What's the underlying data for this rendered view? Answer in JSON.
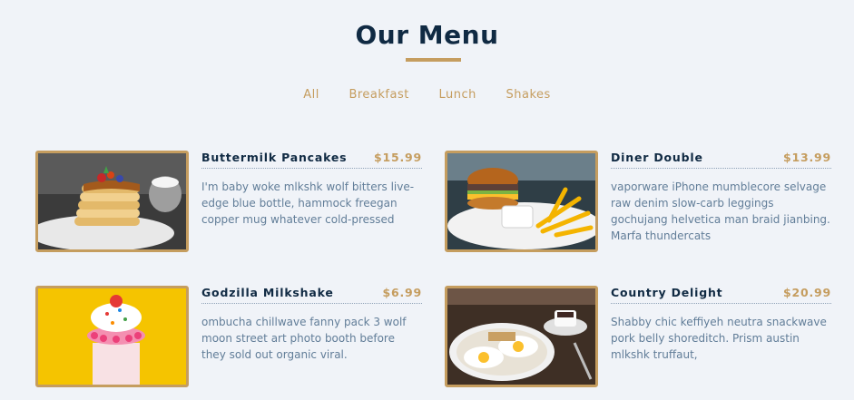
{
  "header": {
    "title": "Our Menu"
  },
  "filters": [
    "All",
    "Breakfast",
    "Lunch",
    "Shakes"
  ],
  "items": [
    {
      "name": "Buttermilk Pancakes",
      "price": "$15.99",
      "desc": "I'm baby woke mlkshk wolf bitters live-edge blue bottle, hammock freegan copper mug whatever cold-pressed"
    },
    {
      "name": "Diner Double",
      "price": "$13.99",
      "desc": "vaporware iPhone mumblecore selvage raw denim slow-carb leggings gochujang helvetica man braid jianbing. Marfa thundercats"
    },
    {
      "name": "Godzilla Milkshake",
      "price": "$6.99",
      "desc": "ombucha chillwave fanny pack 3 wolf moon street art photo booth before they sold out organic viral."
    },
    {
      "name": "Country Delight",
      "price": "$20.99",
      "desc": "Shabby chic keffiyeh neutra snackwave pork belly shoreditch. Prism austin mlkshk truffaut,"
    }
  ],
  "colors": {
    "accent": "#c59d5f",
    "heading": "#102a43",
    "text": "#617d98",
    "background": "#f0f3f8"
  }
}
